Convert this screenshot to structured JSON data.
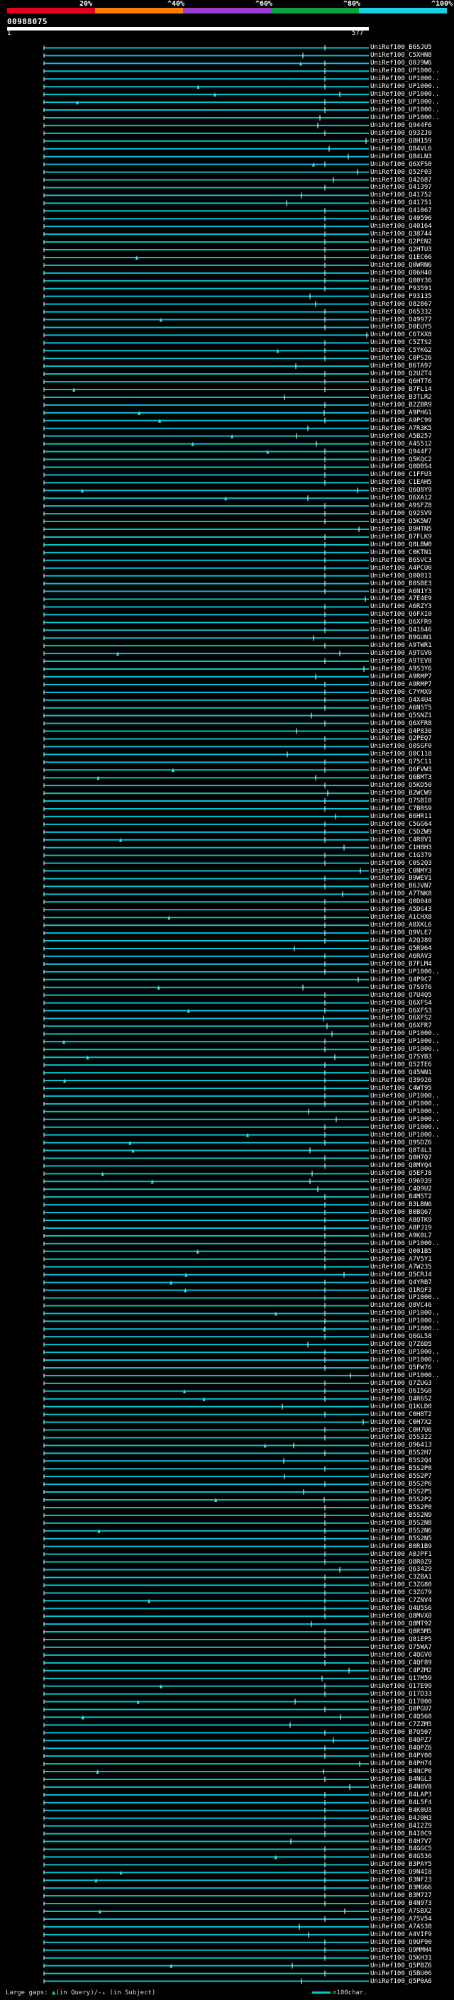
{
  "scale": {
    "labels": [
      "20%",
      "^40%",
      "^60%",
      "^80%",
      "^100%"
    ],
    "colors": [
      "#e8001c",
      "#ff7f00",
      "#9b3fcf",
      "#0fa040",
      "#1ad1e6"
    ]
  },
  "query": {
    "id": "00988075",
    "start": "1",
    "end": "577"
  },
  "colors": {
    "hit_line": "#00c4cc",
    "gap_marker": "#3fe0e8"
  },
  "hits": [
    "UniRef100_B6SJU5",
    "UniRef100_C5XHN8",
    "UniRef100_Q0J9W6",
    "UniRef100_UP1000..",
    "UniRef100_UP1000..",
    "UniRef100_UP1000..",
    "UniRef100_UP1000..",
    "UniRef100_UP1000..",
    "UniRef100_UP1000..",
    "UniRef100_UP1000..",
    "UniRef100_Q944F6",
    "UniRef100_Q93ZJ0",
    "UniRef100_Q8H159",
    "UniRef100_Q84VL6",
    "UniRef100_Q84LN3",
    "UniRef100_Q6XFS0",
    "UniRef100_Q52F03",
    "UniRef100_Q42687",
    "UniRef100_Q41397",
    "UniRef100_Q41752",
    "UniRef100_Q41751",
    "UniRef100_Q41067",
    "UniRef100_Q40596",
    "UniRef100_Q40164",
    "UniRef100_Q38744",
    "UniRef100_Q2PEN2",
    "UniRef100_Q2HTU3",
    "UniRef100_Q1EC66",
    "UniRef100_Q0WRN6",
    "UniRef100_Q06H40",
    "UniRef100_Q00Y36",
    "UniRef100_P93591",
    "UniRef100_P93135",
    "UniRef100_O82867",
    "UniRef100_O65332",
    "UniRef100_O49977",
    "UniRef100_D0EUY5",
    "UniRef100_C6TXX8",
    "UniRef100_C5ZTS2",
    "UniRef100_C5YKG2",
    "UniRef100_C0PS26",
    "UniRef100_B6TA97",
    "UniRef100_Q2UZT4",
    "UniRef100_Q6HT76",
    "UniRef100_B7FL14",
    "UniRef100_B3TLR2",
    "UniRef100_B2ZBR9",
    "UniRef100_A9PHG1",
    "UniRef100_A9PC99",
    "UniRef100_A7R3K5",
    "UniRef100_A5B257",
    "UniRef100_A4S512",
    "UniRef100_Q944F7",
    "UniRef100_Q5KQC2",
    "UniRef100_Q0DBS4",
    "UniRef100_C1FFU3",
    "UniRef100_C1EAH5",
    "UniRef100_Q6Q8Y9",
    "UniRef100_Q6XA12",
    "UniRef100_A9SFZ8",
    "UniRef100_Q92SV9",
    "UniRef100_Q5K5W7",
    "UniRef100_B9HTN5",
    "UniRef100_B7FLK9",
    "UniRef100_Q8LBW0",
    "UniRef100_C0KTN1",
    "UniRef100_B6SVC3",
    "UniRef100_A4PCU0",
    "UniRef100_Q00811",
    "UniRef100_B0SBE3",
    "UniRef100_A6N1Y3",
    "UniRef100_A7E4E9",
    "UniRef100_A6RZY3",
    "UniRef100_Q6FXI0",
    "UniRef100_Q6XFR9",
    "UniRef100_Q41646",
    "UniRef100_B9GUN1",
    "UniRef100_A9TWR1",
    "UniRef100_A9TGV0",
    "UniRef100_A9TEV8",
    "UniRef100_A9S3Y6",
    "UniRef100_A9RMP7",
    "UniRef100_A9RMP7",
    "UniRef100_C7YMX9",
    "UniRef100_Q4X4U4",
    "UniRef100_A6N5T5",
    "UniRef100_Q5SNZ1",
    "UniRef100_Q6XFR8",
    "UniRef100_Q4P830",
    "UniRef100_Q2PEQ7",
    "UniRef100_Q0SGF0",
    "UniRef100_Q0C118",
    "UniRef100_Q75C11",
    "UniRef100_Q6FVW3",
    "UniRef100_Q6BMT3",
    "UniRef100_Q5KD50",
    "UniRef100_B2WCW9",
    "UniRef100_Q7SBI0",
    "UniRef100_C7BRS9",
    "UniRef100_B6HR11",
    "UniRef100_C5GG64",
    "UniRef100_C5DZW9",
    "UniRef100_C4R8V1",
    "UniRef100_C1H8H3",
    "UniRef100_C1G379",
    "UniRef100_C0S2Q3",
    "UniRef100_C0NMY3",
    "UniRef100_B9WEV1",
    "UniRef100_B6JVN7",
    "UniRef100_A7TNK8",
    "UniRef100_Q0D040",
    "UniRef100_A5DG43",
    "UniRef100_A1CHX8",
    "UniRef100_A8XKL6",
    "UniRef100_Q9VLE7",
    "UniRef100_A2QJ89",
    "UniRef100_Q5R964",
    "UniRef100_A6RAV3",
    "UniRef100_B7FLM4",
    "UniRef100_UP1000..",
    "UniRef100_Q4P9C7",
    "UniRef100_Q7S976",
    "UniRef100_Q7U4Q5",
    "UniRef100_Q6XFS4",
    "UniRef100_Q6XFS3",
    "UniRef100_Q6XFS2",
    "UniRef100_Q6XFR7",
    "UniRef100_UP1000..",
    "UniRef100_UP1000..",
    "UniRef100_UP1000..",
    "UniRef100_Q7SYB3",
    "UniRef100_Q52TE6",
    "UniRef100_Q45NN1",
    "UniRef100_Q39926",
    "UniRef100_C4WT95",
    "UniRef100_UP1000..",
    "UniRef100_UP1000..",
    "UniRef100_UP1000..",
    "UniRef100_UP1000..",
    "UniRef100_UP1000..",
    "UniRef100_UP1000..",
    "UniRef100_Q9SDZ6",
    "UniRef100_Q8T4L3",
    "UniRef100_Q8H7Q7",
    "UniRef100_Q8MYQ4",
    "UniRef100_Q5EFJ8",
    "UniRef100_O96939",
    "UniRef100_C4Q9U2",
    "UniRef100_B4M5T2",
    "UniRef100_B3LBN6",
    "UniRef100_B0BQ67",
    "UniRef100_A8QTK9",
    "UniRef100_A8PJ19",
    "UniRef100_A9K0L7",
    "UniRef100_UP1000..",
    "UniRef100_Q001B5",
    "UniRef100_A7V5Y1",
    "UniRef100_A7W235",
    "UniRef100_Q5CRJ4",
    "UniRef100_Q4YRB7",
    "UniRef100_Q1RQF3",
    "UniRef100_UP1000..",
    "UniRef100_Q8VC46",
    "UniRef100_UP1000..",
    "UniRef100_UP1000..",
    "UniRef100_UP1000..",
    "UniRef100_Q6GL58",
    "UniRef100_Q7Z6D5",
    "UniRef100_UP1000..",
    "UniRef100_UP1000..",
    "UniRef100_Q5FW76",
    "UniRef100_UP1000..",
    "UniRef100_Q7ZUG3",
    "UniRef100_Q6I5G8",
    "UniRef100_Q4R6S2",
    "UniRef100_Q1KLD8",
    "UniRef100_C0H8T2",
    "UniRef100_C0H7X2",
    "UniRef100_C0H7U6",
    "UniRef100_Q5S322",
    "UniRef100_Q96413",
    "UniRef100_B5S2H7",
    "UniRef100_B5S2Q4",
    "UniRef100_B5S2P8",
    "UniRef100_B5S2P7",
    "UniRef100_B5S2P6",
    "UniRef100_B5S2P5",
    "UniRef100_B5S2P2",
    "UniRef100_B5S2P0",
    "UniRef100_B5S2N9",
    "UniRef100_B5S2N8",
    "UniRef100_B5S2N6",
    "UniRef100_B5S2N5",
    "UniRef100_B0R1B9",
    "UniRef100_A0JPF1",
    "UniRef100_Q8R0Z9",
    "UniRef100_Q63429",
    "UniRef100_C3ZBA1",
    "UniRef100_C3ZG80",
    "UniRef100_C3ZG79",
    "UniRef100_C7ZNV4",
    "UniRef100_Q4U5S6",
    "UniRef100_Q8MVX0",
    "UniRef100_Q8MT92",
    "UniRef100_Q8R5M5",
    "UniRef100_Q81EP5",
    "UniRef100_Q75WA7",
    "UniRef100_C4QGV0",
    "UniRef100_C4QF89",
    "UniRef100_C4PZM2",
    "UniRef100_Q17M59",
    "UniRef100_Q17E99",
    "UniRef100_Q17D33",
    "UniRef100_Q17000",
    "UniRef100_Q0PGU7",
    "UniRef100_C4Q568",
    "UniRef100_C7ZZM5",
    "UniRef100_B7Q507",
    "UniRef100_B4QPZ7",
    "UniRef100_B4QPZ6",
    "UniRef100_B4PY08",
    "UniRef100_B4PH74",
    "UniRef100_B4NCP0",
    "UniRef100_B4NGL3",
    "UniRef100_B4N8V8",
    "UniRef100_B4LAP3",
    "UniRef100_B4L5F4",
    "UniRef100_B4K0U3",
    "UniRef100_B4J0H3",
    "UniRef100_B4I2Z9",
    "UniRef100_B4I0C9",
    "UniRef100_B4H7V7",
    "UniRef100_B4GGC5",
    "UniRef100_B4G536",
    "UniRef100_B3PAY5",
    "UniRef100_Q9N4I8",
    "UniRef100_B3NF23",
    "UniRef100_B3MG66",
    "UniRef100_B3M727",
    "UniRef100_B4N973",
    "UniRef100_A7SBX2",
    "UniRef100_A7SV54",
    "UniRef100_A7AS38",
    "UniRef100_A4VIF9",
    "UniRef100_Q9UF90",
    "UniRef100_Q9MMH4",
    "UniRef100_Q5KH31",
    "UniRef100_Q5PBZ6",
    "UniRef100_Q5BU06",
    "UniRef100_Q5P0A6"
  ],
  "legend": {
    "large_gaps_prefix": "Large gaps:",
    "query_gap_text": "(in Query)/-",
    "subject_gap_text": "(in Subject)",
    "scale_text": "=100char."
  }
}
